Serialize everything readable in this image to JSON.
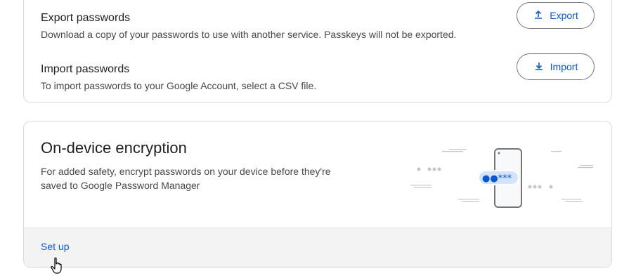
{
  "export": {
    "title": "Export passwords",
    "description": "Download a copy of your passwords to use with another service. Passkeys will not be exported.",
    "button_label": "Export",
    "icon": "upload-icon"
  },
  "import": {
    "title": "Import passwords",
    "description": "To import passwords to your Google Account, select a CSV file.",
    "button_label": "Import",
    "icon": "download-icon"
  },
  "encryption": {
    "title": "On-device encryption",
    "description": "For added safety, encrypt passwords on your device before they're saved to Google Password Manager",
    "setup_label": "Set up",
    "illustration_text": "●●***"
  },
  "colors": {
    "accent": "#0b57d0",
    "border": "#dadce0",
    "footer_bg": "#f3f3f3"
  }
}
